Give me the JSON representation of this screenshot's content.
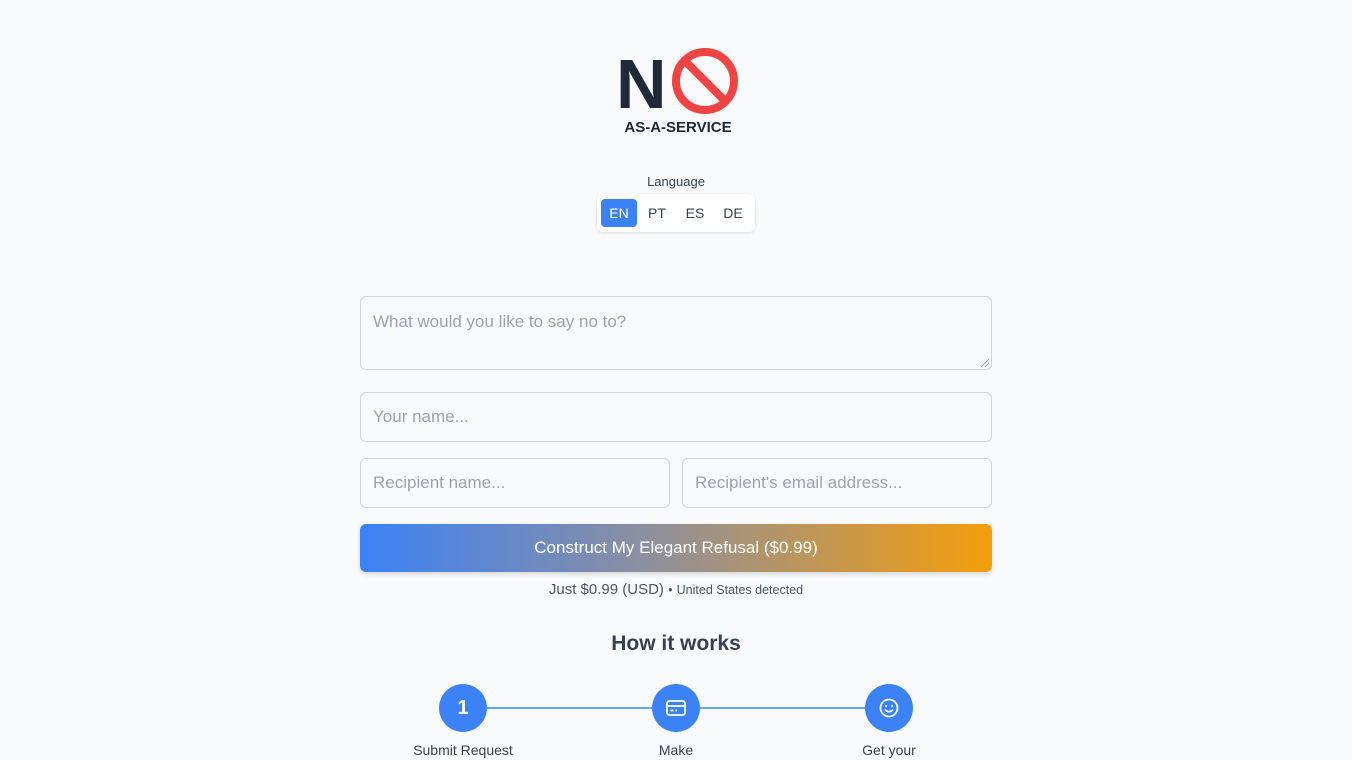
{
  "logo": {
    "letter": "N",
    "subtitle": "AS-A-SERVICE"
  },
  "language": {
    "label": "Language",
    "options": [
      "EN",
      "PT",
      "ES",
      "DE"
    ],
    "selected": "EN"
  },
  "form": {
    "message_placeholder": "What would you like to say no to?",
    "name_placeholder": "Your name...",
    "recipient_name_placeholder": "Recipient name...",
    "recipient_email_placeholder": "Recipient's email address...",
    "submit_label": "Construct My Elegant Refusal ($0.99)"
  },
  "pricing": {
    "note": "Just $0.99 (USD)",
    "separator": "•",
    "country": "United States detected"
  },
  "how_it_works": {
    "title": "How it works",
    "steps": [
      {
        "number": "1",
        "label": "Submit Request"
      },
      {
        "icon": "credit-card-icon",
        "label": "Make"
      },
      {
        "icon": "smiley-icon",
        "label": "Get your"
      }
    ]
  },
  "colors": {
    "accent": "#3b82f6",
    "logo_red": "#ef4444",
    "cta_end": "#f59e0b"
  }
}
